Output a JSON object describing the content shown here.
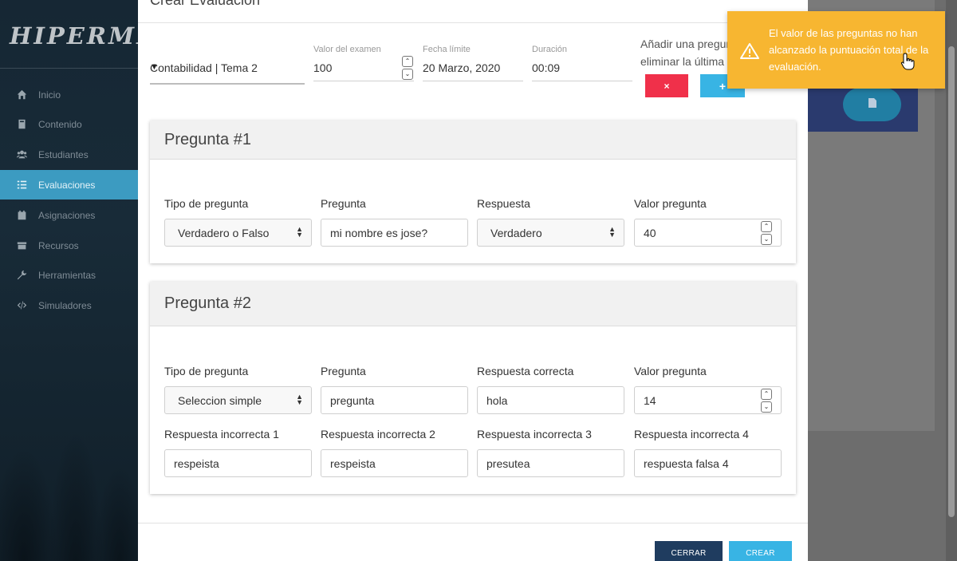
{
  "sidebar": {
    "logo": "HIPERMED",
    "items": [
      {
        "label": "Inicio",
        "icon": "home-icon"
      },
      {
        "label": "Contenido",
        "icon": "book-icon"
      },
      {
        "label": "Estudiantes",
        "icon": "users-icon"
      },
      {
        "label": "Evaluaciones",
        "icon": "tasks-icon"
      },
      {
        "label": "Asignaciones",
        "icon": "calendar-icon"
      },
      {
        "label": "Recursos",
        "icon": "folder-icon"
      },
      {
        "label": "Herramientas",
        "icon": "wrench-icon"
      },
      {
        "label": "Simuladores",
        "icon": "code-icon"
      }
    ],
    "active_index": 3
  },
  "modal": {
    "title": "Crear Evaluación",
    "course_select": "Contabilidad | Tema 2",
    "exam_value": {
      "label": "Valor del examen",
      "value": "100"
    },
    "deadline": {
      "label": "Fecha límite",
      "value": "20 Marzo, 2020"
    },
    "duration": {
      "label": "Duración",
      "value": "00:09"
    },
    "add_question_text_line1": "Añadir una pregunta",
    "add_question_text_line2": "eliminar la última",
    "remove_button": "×",
    "add_button": "+",
    "questions": [
      {
        "title": "Pregunta #1",
        "type_label": "Tipo de pregunta",
        "type_value": "Verdadero o Falso",
        "question_label": "Pregunta",
        "question_value": "mi nombre es jose?",
        "answer_label": "Respuesta",
        "answer_value": "Verdadero",
        "points_label": "Valor pregunta",
        "points_value": "40"
      },
      {
        "title": "Pregunta #2",
        "type_label": "Tipo de pregunta",
        "type_value": "Seleccion simple",
        "question_label": "Pregunta",
        "question_value": "pregunta",
        "answer_label": "Respuesta correcta",
        "answer_value": "hola",
        "points_label": "Valor pregunta",
        "points_value": "14",
        "wrong_answers": [
          {
            "label": "Respuesta incorrecta 1",
            "value": "respeista"
          },
          {
            "label": "Respuesta incorrecta 2",
            "value": "respeista"
          },
          {
            "label": "Respuesta incorrecta 3",
            "value": "presutea"
          },
          {
            "label": "Respuesta incorrecta 4",
            "value": "respuesta falsa 4"
          }
        ]
      }
    ],
    "close_button": "CERRAR",
    "create_button": "CREAR"
  },
  "toast": {
    "message": "El valor de las preguntas no han alcanzado la puntuación total de la evaluación.",
    "icon": "warning-icon",
    "color": "#f7b631"
  },
  "colors": {
    "accent": "#3c9bc1",
    "danger": "#f0304a",
    "primary_light": "#38b4e4",
    "navy": "#1f3c5f"
  }
}
